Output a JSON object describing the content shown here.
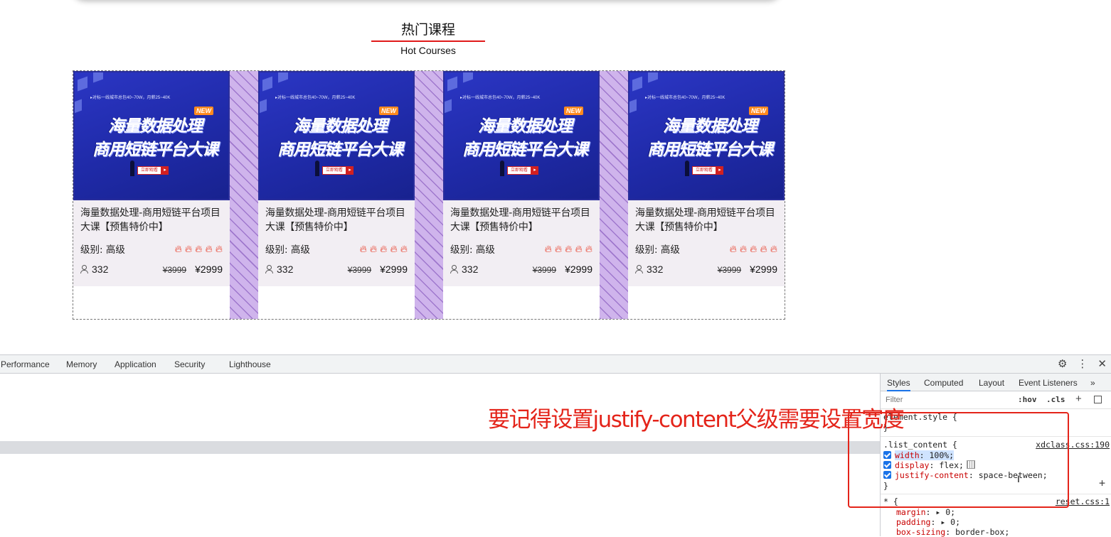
{
  "section": {
    "title_cn": "热门课程",
    "title_en": "Hot Courses"
  },
  "courses": [
    {
      "banner_tagline": "▸对标一线城市总包40~70W，月薪25~40K",
      "banner_new": "NEW",
      "banner_line1": "海量数据处理",
      "banner_line2": "商用短链平台大课",
      "banner_cta": "立即观看",
      "title": "海量数据处理-商用短链平台项目大课【预售特价中】",
      "level": "级别: 高级",
      "rating": 5,
      "students": "332",
      "old_price": "¥3999",
      "price": "¥2999"
    },
    {
      "banner_tagline": "▸对标一线城市总包40~70W，月薪25~40K",
      "banner_new": "NEW",
      "banner_line1": "海量数据处理",
      "banner_line2": "商用短链平台大课",
      "banner_cta": "立即观看",
      "title": "海量数据处理-商用短链平台项目大课【预售特价中】",
      "level": "级别: 高级",
      "rating": 5,
      "students": "332",
      "old_price": "¥3999",
      "price": "¥2999"
    },
    {
      "banner_tagline": "▸对标一线城市总包40~70W，月薪25~40K",
      "banner_new": "NEW",
      "banner_line1": "海量数据处理",
      "banner_line2": "商用短链平台大课",
      "banner_cta": "立即观看",
      "title": "海量数据处理-商用短链平台项目大课【预售特价中】",
      "level": "级别: 高级",
      "rating": 5,
      "students": "332",
      "old_price": "¥3999",
      "price": "¥2999"
    },
    {
      "banner_tagline": "▸对标一线城市总包40~70W，月薪25~40K",
      "banner_new": "NEW",
      "banner_line1": "海量数据处理",
      "banner_line2": "商用短链平台大课",
      "banner_cta": "立即观看",
      "title": "海量数据处理-商用短链平台项目大课【预售特价中】",
      "level": "级别: 高级",
      "rating": 5,
      "students": "332",
      "old_price": "¥3999",
      "price": "¥2999"
    }
  ],
  "devtools": {
    "tabs": [
      "Performance",
      "Memory",
      "Application",
      "Security",
      "Lighthouse"
    ],
    "tools": {
      "settings": "⚙",
      "more": "⋮",
      "close": "✕"
    },
    "styles_tabs": [
      "Styles",
      "Computed",
      "Layout",
      "Event Listeners",
      "»"
    ],
    "filter_placeholder": "Filter",
    "hov": ":hov",
    "cls": ".cls",
    "element_style": {
      "selector": "element.style {",
      "close": "}"
    },
    "rule1": {
      "selector": ".list_content {",
      "source": "xdclass.css:190",
      "decls": [
        {
          "prop": "width",
          "value": "100%;"
        },
        {
          "prop": "display",
          "value": "flex;"
        },
        {
          "prop": "justify-content",
          "value": "space-between;"
        }
      ],
      "close": "}"
    },
    "rule2": {
      "selector": "* {",
      "source": "reset.css:1",
      "decls": [
        {
          "prop": "margin",
          "value": "▸ 0;"
        },
        {
          "prop": "padding",
          "value": "▸ 0;"
        },
        {
          "prop": "box-sizing",
          "value": "border-box;"
        }
      ]
    }
  },
  "annotation": "要记得设置justify-content父级需要设置宽度",
  "colors": {
    "accent_red": "#e4241a",
    "banner_blue": "#1f2aa8",
    "gap_purple": "#cfb4ec",
    "devtools_blue": "#1a73e8"
  }
}
